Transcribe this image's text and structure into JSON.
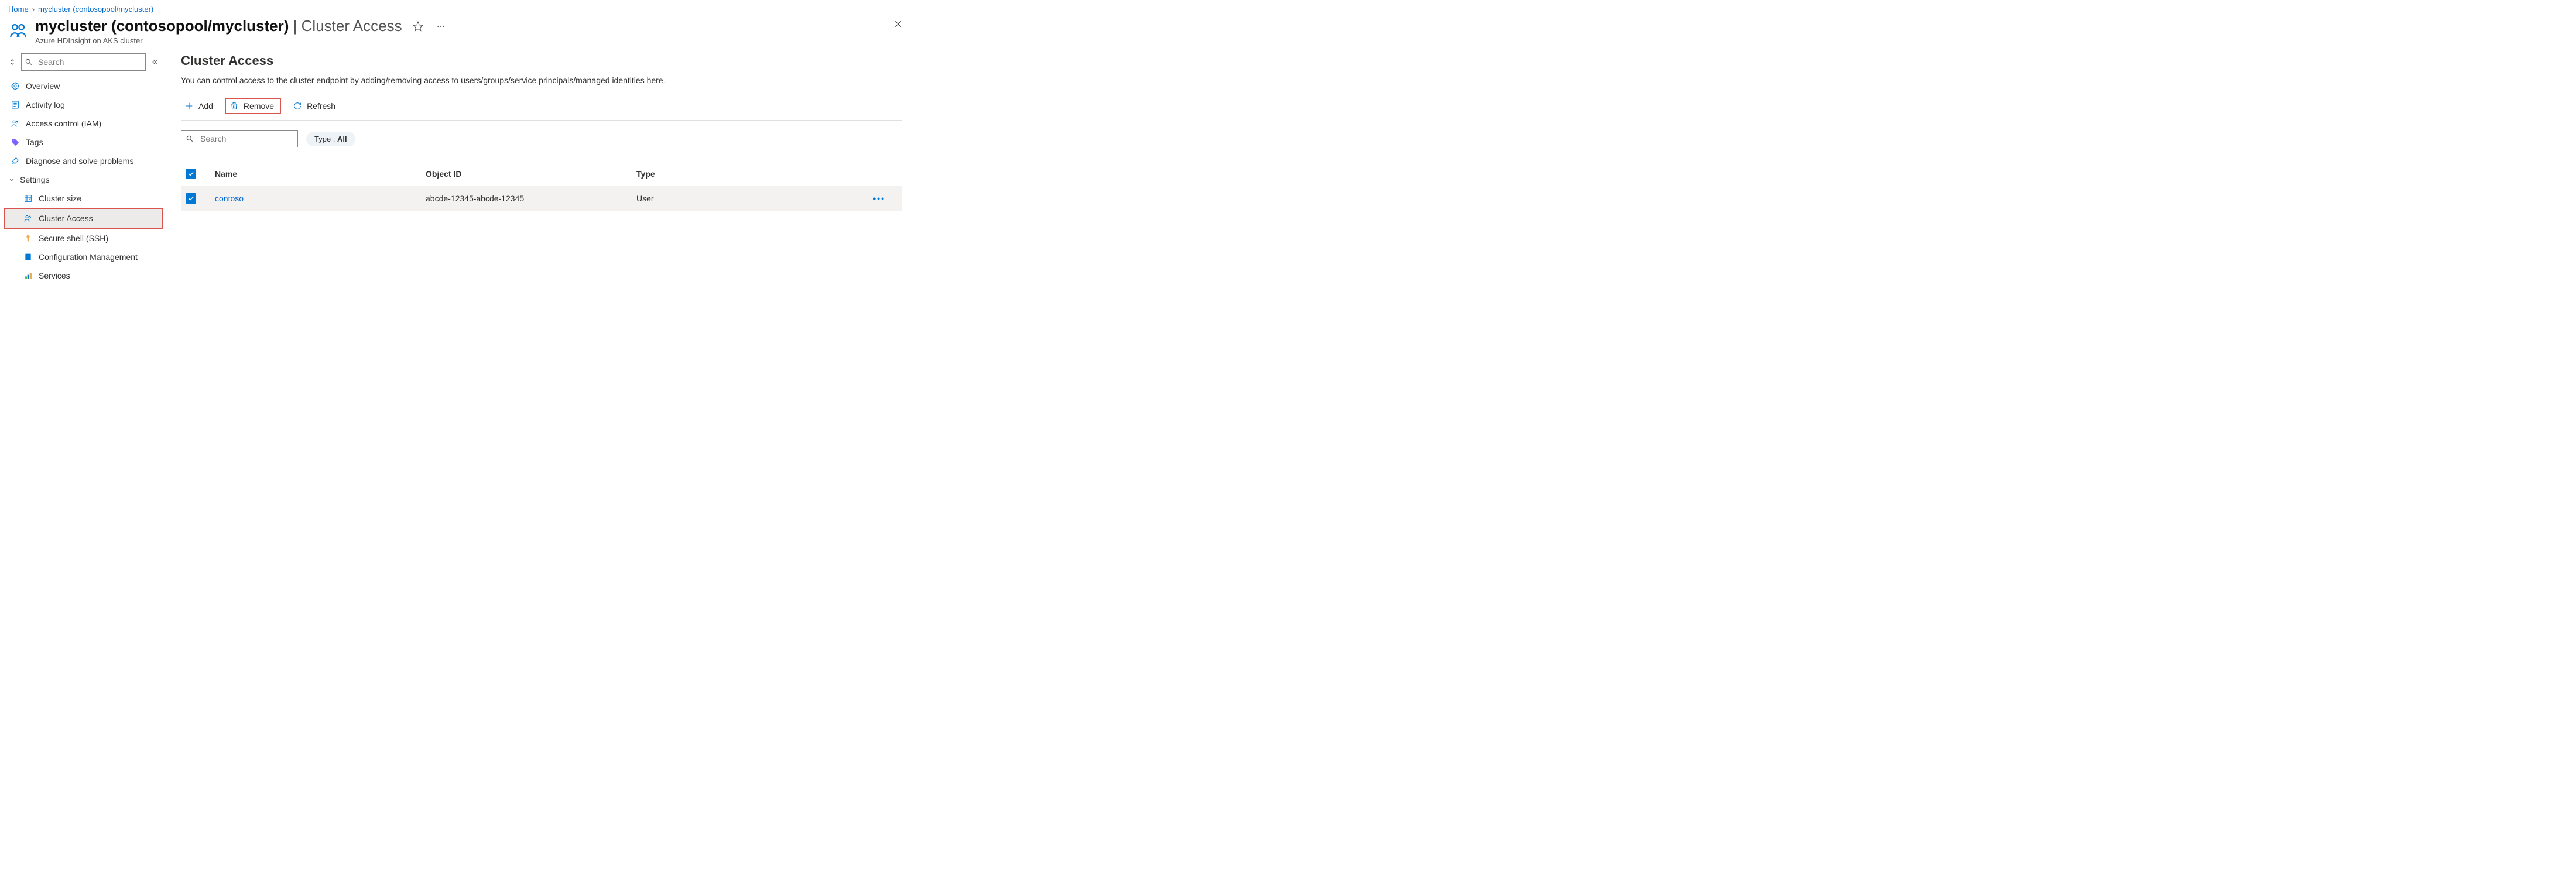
{
  "breadcrumb": {
    "home": "Home",
    "current": "mycluster (contosopool/mycluster)"
  },
  "header": {
    "title_main": "mycluster (contosopool/mycluster)",
    "title_suffix": "Cluster Access",
    "subtitle": "Azure HDInsight on AKS cluster"
  },
  "sidebar": {
    "search_placeholder": "Search",
    "items": {
      "overview": "Overview",
      "activity_log": "Activity log",
      "access_control": "Access control (IAM)",
      "tags": "Tags",
      "diagnose": "Diagnose and solve problems"
    },
    "settings_label": "Settings",
    "settings_items": {
      "cluster_size": "Cluster size",
      "cluster_access": "Cluster Access",
      "secure_shell": "Secure shell (SSH)",
      "config_mgmt": "Configuration Management",
      "services": "Services"
    }
  },
  "main": {
    "title": "Cluster Access",
    "description": "You can control access to the cluster endpoint by adding/removing access to users/groups/service principals/managed identities here.",
    "toolbar": {
      "add": "Add",
      "remove": "Remove",
      "refresh": "Refresh"
    },
    "filter": {
      "search_placeholder": "Search",
      "type_label": "Type : ",
      "type_value": "All"
    },
    "table": {
      "headers": {
        "name": "Name",
        "object_id": "Object ID",
        "type": "Type"
      },
      "rows": [
        {
          "name": "contoso",
          "object_id": "abcde-12345-abcde-12345",
          "type": "User"
        }
      ]
    }
  }
}
